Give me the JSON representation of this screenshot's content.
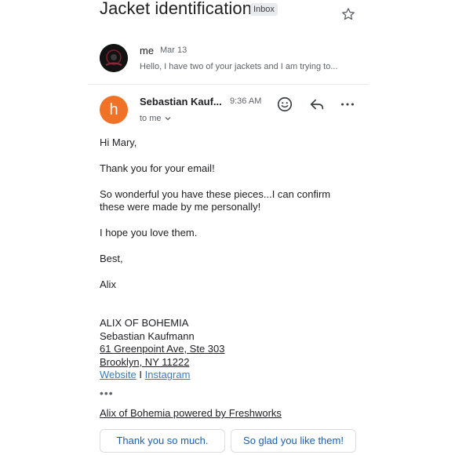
{
  "email": {
    "subject": "Jacket identification",
    "label": "Inbox",
    "thread": [
      {
        "sender": "me",
        "date": "Mar 13",
        "snippet": "Hello, I have two of your jackets and I am trying to..."
      },
      {
        "avatar_letter": "h",
        "sender": "Sebastian Kauf...",
        "time": "9:36 AM",
        "recipient": "to me",
        "body": [
          "Hi Mary,",
          "Thank you for your email!",
          "So wonderful you have these pieces...I can confirm",
          "these were made by me personally!",
          "I hope you love them.",
          "Best,",
          "Alix"
        ],
        "signature": {
          "company": "ALIX OF BOHEMIA",
          "name": "Sebastian Kaufmann",
          "address_line1": "61 Greenpoint Ave, Ste 303",
          "address_line2": "Brooklyn, NY 11222",
          "website": "Website",
          "separator": "I",
          "instagram": "Instagram"
        },
        "powered_by": "Alix of Bohemia powered by Freshworks"
      }
    ]
  },
  "smart_replies": [
    "Thank you so much.",
    "So glad you like them!"
  ],
  "colors": {
    "avatar_orange": "#f07226",
    "link_blue": "#3b7bbf",
    "reply_blue": "#1a5fb4"
  },
  "icons": [
    "star-icon",
    "emoji-icon",
    "reply-icon",
    "more-icon",
    "chevron-down-icon"
  ]
}
